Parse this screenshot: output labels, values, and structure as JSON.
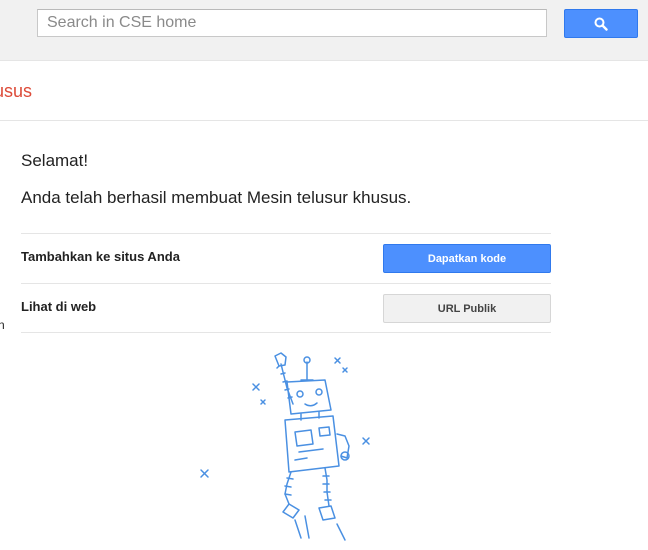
{
  "search": {
    "placeholder": "Search in CSE home"
  },
  "icons": {
    "search": "search-icon",
    "robot": "robot-illustration"
  },
  "colors": {
    "brand_red": "#dd4b39",
    "accent_blue": "#4d90fe",
    "robot_blue": "#4a90e2"
  },
  "header": {
    "brand_fragment": "usus"
  },
  "side": {
    "fragment": "n"
  },
  "main": {
    "headline": "Selamat!",
    "message": "Anda telah berhasil membuat Mesin telusur khusus.",
    "rows": [
      {
        "label": "Tambahkan ke situs Anda",
        "button": "Dapatkan kode"
      },
      {
        "label": "Lihat di web",
        "button": "URL Publik"
      }
    ]
  }
}
